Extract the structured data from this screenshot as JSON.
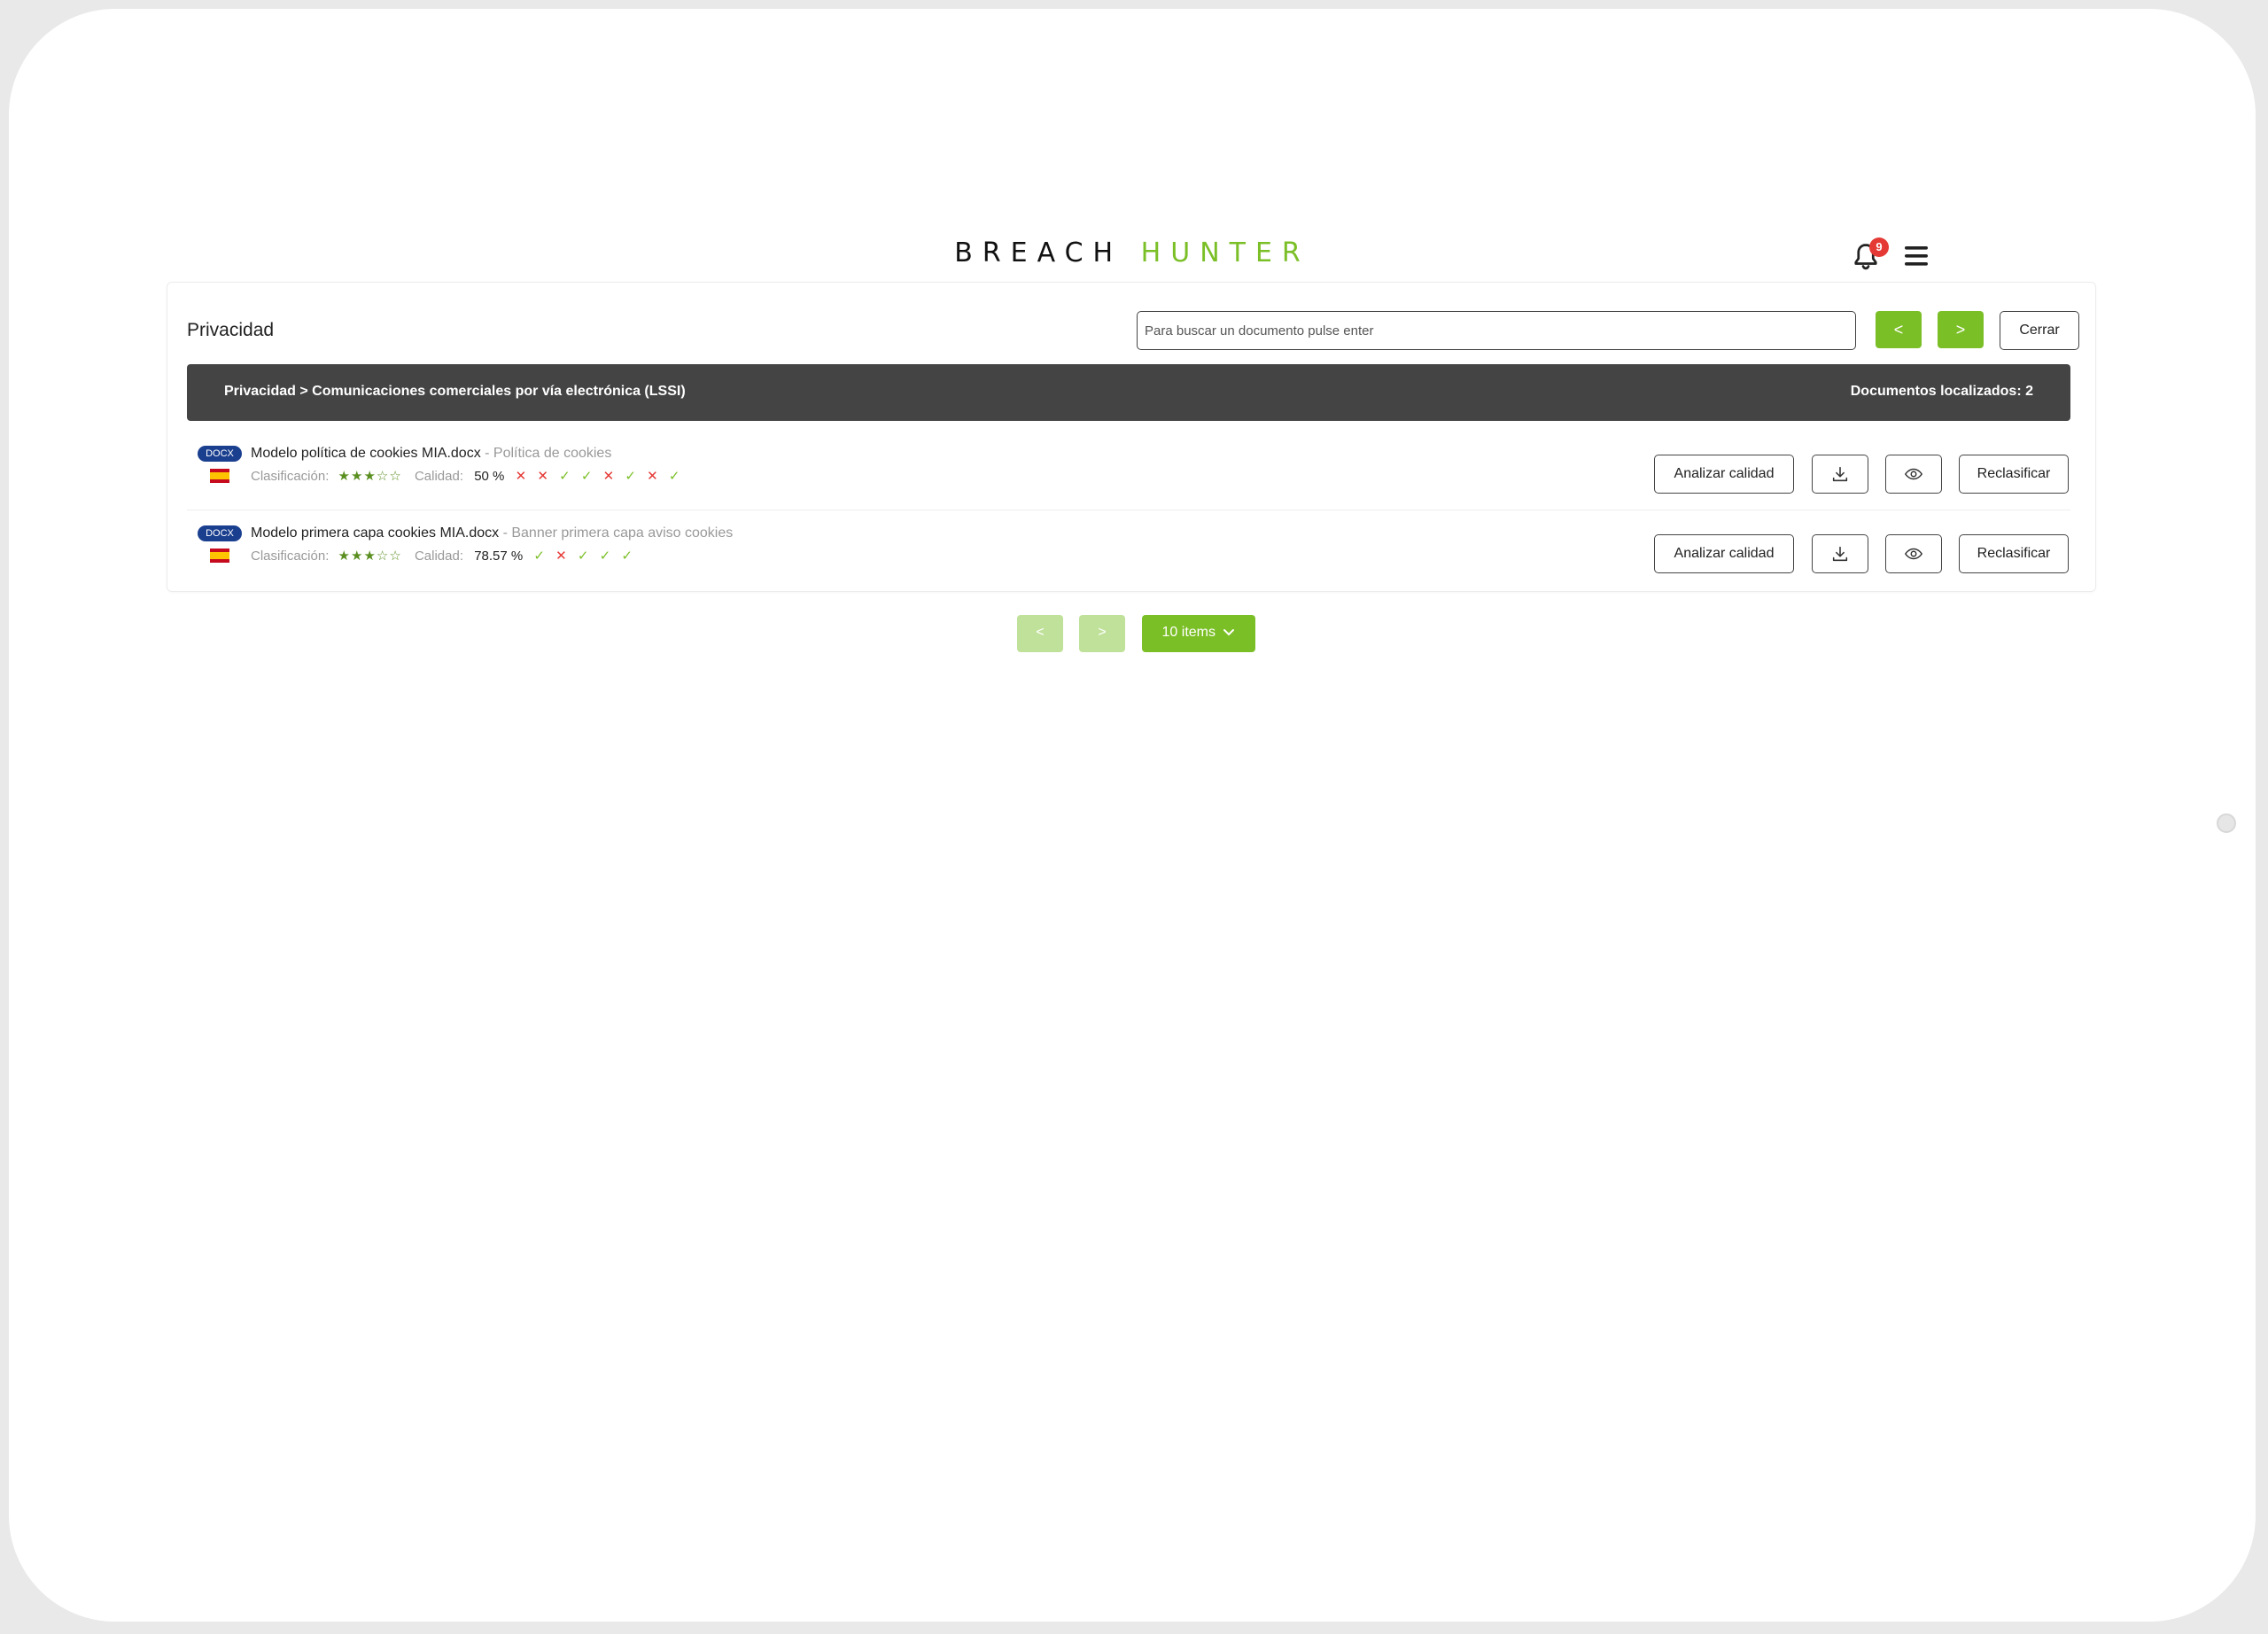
{
  "header": {
    "logo_part1": "BREACH",
    "logo_part2": "HUNTER",
    "notifications_count": "9"
  },
  "panel": {
    "title": "Privacidad",
    "search_placeholder": "Para buscar un documento pulse enter",
    "prev_label": "<",
    "next_label": ">",
    "close_label": "Cerrar"
  },
  "bar": {
    "breadcrumb": "Privacidad > Comunicaciones comerciales por vía electrónica (LSSI)",
    "found_text": "Documentos localizados: 2"
  },
  "documents": [
    {
      "type_badge": "DOCX",
      "name": "Modelo política de cookies MIA.docx",
      "separator": " - ",
      "category": "Política de cookies",
      "classification_label": "Clasificación:",
      "stars": "★★★☆☆",
      "quality_label": "Calidad:",
      "quality_value": "50 %",
      "checks": [
        "✕",
        "✕",
        "✓",
        "✓",
        "✕",
        "✓",
        "✕",
        "✓"
      ],
      "btn_analyze": "Analizar calidad",
      "btn_reclassify": "Reclasificar"
    },
    {
      "type_badge": "DOCX",
      "name": "Modelo primera capa cookies MIA.docx",
      "separator": " - ",
      "category": "Banner primera capa aviso cookies",
      "classification_label": "Clasificación:",
      "stars": "★★★☆☆",
      "quality_label": "Calidad:",
      "quality_value": "78.57 %",
      "checks": [
        "✓",
        "✕",
        "✓",
        "✓",
        "✓"
      ],
      "btn_analyze": "Analizar calidad",
      "btn_reclassify": "Reclasificar"
    }
  ],
  "pagination": {
    "prev_label": "<",
    "next_label": ">",
    "items_label": "10 items"
  },
  "icons": {
    "bell": "bell-icon",
    "menu": "hamburger-menu-icon",
    "download": "download-icon",
    "view": "eye-icon",
    "flag": "spain-flag-icon",
    "dropdown": "chevron-down-icon"
  },
  "colors": {
    "brand_green": "#7bbf27",
    "brand_green_light": "#c0e19a",
    "bar_dark": "#444444",
    "badge_blue": "#1a3f8f",
    "error_red": "#e53935"
  }
}
